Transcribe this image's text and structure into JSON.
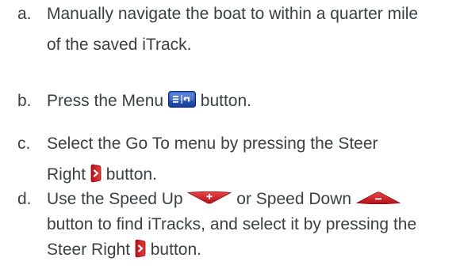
{
  "steps": [
    {
      "marker": "a.",
      "lines": [
        "Manually navigate the boat to within a quarter mile",
        "of the saved iTrack."
      ]
    },
    {
      "marker": "b.",
      "text_before": "Press the Menu",
      "icon": "menu-button-icon",
      "text_after": "button."
    },
    {
      "marker": "c.",
      "line1": "Select the Go To menu by pressing the Steer",
      "text_before": "Right",
      "icon": "steer-right-button-icon",
      "text_after": "button."
    },
    {
      "marker": "d.",
      "text_1": "Use the Speed Up",
      "icon_1": "speed-up-button-icon",
      "text_2": "or Speed Down",
      "icon_2": "speed-down-button-icon",
      "line2": "button to find iTracks, and select it by pressing the",
      "text_3": "Steer Right",
      "icon_3": "steer-right-button-icon",
      "text_4": "button."
    }
  ],
  "colors": {
    "text": "#3c4043",
    "menu_button": "#1f4fb8",
    "steer_button": "#d8242a",
    "speed_button": "#d8242a"
  }
}
